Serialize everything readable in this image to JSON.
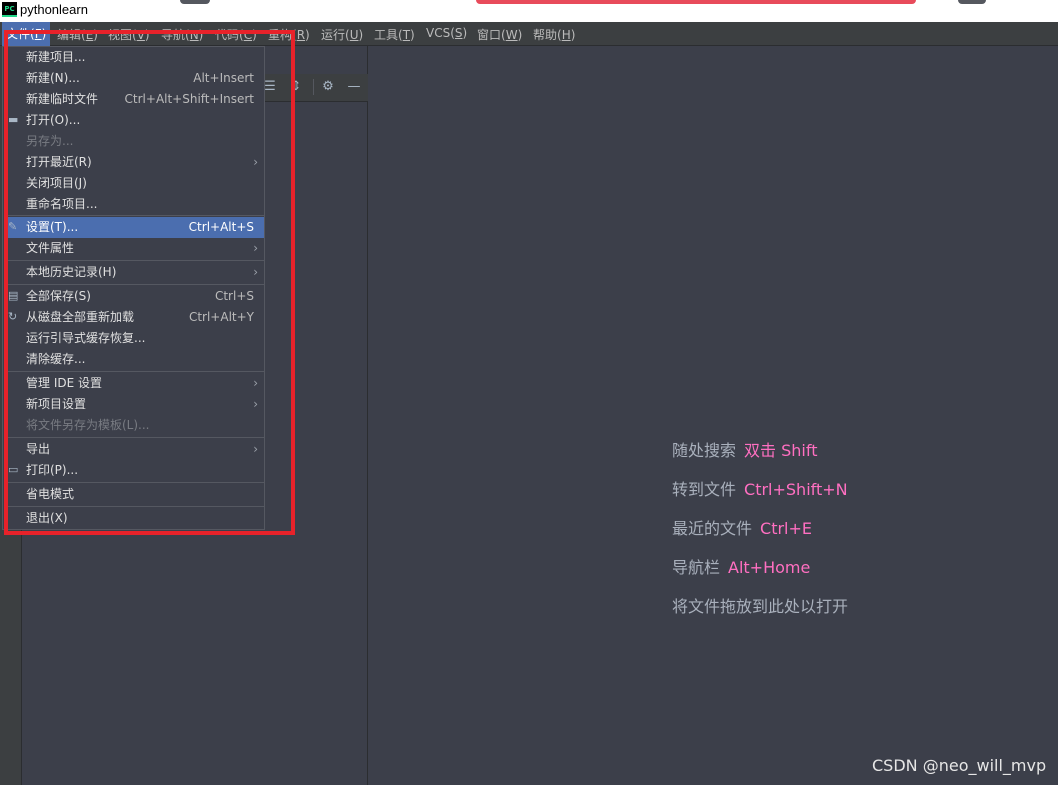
{
  "window": {
    "title": "pythonlearn",
    "app_icon_text": "PC"
  },
  "menubar": [
    {
      "label": "文件(",
      "key": "F",
      "suffix": ")"
    },
    {
      "label": "编辑(",
      "key": "E",
      "suffix": ")"
    },
    {
      "label": "视图(",
      "key": "V",
      "suffix": ")"
    },
    {
      "label": "导航(",
      "key": "N",
      "suffix": ")"
    },
    {
      "label": "代码(",
      "key": "C",
      "suffix": ")"
    },
    {
      "label": "重构(",
      "key": "R",
      "suffix": ")"
    },
    {
      "label": "运行(",
      "key": "U",
      "suffix": ")"
    },
    {
      "label": "工具(",
      "key": "T",
      "suffix": ")"
    },
    {
      "label": "VCS(",
      "key": "S",
      "suffix": ")"
    },
    {
      "label": "窗口(",
      "key": "W",
      "suffix": ")"
    },
    {
      "label": "帮助(",
      "key": "H",
      "suffix": ")"
    }
  ],
  "file_menu": {
    "new_project": "新建项目...",
    "new": "新建(N)...",
    "new_shortcut": "Alt+Insert",
    "new_scratch": "新建临时文件",
    "new_scratch_shortcut": "Ctrl+Alt+Shift+Insert",
    "open": "打开(O)...",
    "save_as": "另存为...",
    "open_recent": "打开最近(R)",
    "close_project": "关闭项目(J)",
    "rename_project": "重命名项目...",
    "settings": "设置(T)...",
    "settings_shortcut": "Ctrl+Alt+S",
    "file_properties": "文件属性",
    "local_history": "本地历史记录(H)",
    "save_all": "全部保存(S)",
    "save_all_shortcut": "Ctrl+S",
    "reload_all": "从磁盘全部重新加载",
    "reload_all_shortcut": "Ctrl+Alt+Y",
    "repair_ide": "运行引导式缓存恢复...",
    "invalidate_caches": "清除缓存...",
    "manage_ide_settings": "管理 IDE 设置",
    "new_project_settings": "新项目设置",
    "save_as_template": "将文件另存为模板(L)...",
    "export": "导出",
    "print": "打印(P)...",
    "power_save": "省电模式",
    "exit": "退出(X)"
  },
  "welcome_hints": [
    {
      "label": "随处搜索",
      "key": "双击 Shift"
    },
    {
      "label": "转到文件",
      "key": "Ctrl+Shift+N"
    },
    {
      "label": "最近的文件",
      "key": "Ctrl+E"
    },
    {
      "label": "导航栏",
      "key": "Alt+Home"
    },
    {
      "label": "将文件拖放到此处以打开",
      "key": ""
    }
  ],
  "watermark": "CSDN @neo_will_mvp",
  "colors": {
    "accent": "#4b6eaf",
    "highlight": "#e8222a",
    "shortcut": "#ff6fc1"
  }
}
